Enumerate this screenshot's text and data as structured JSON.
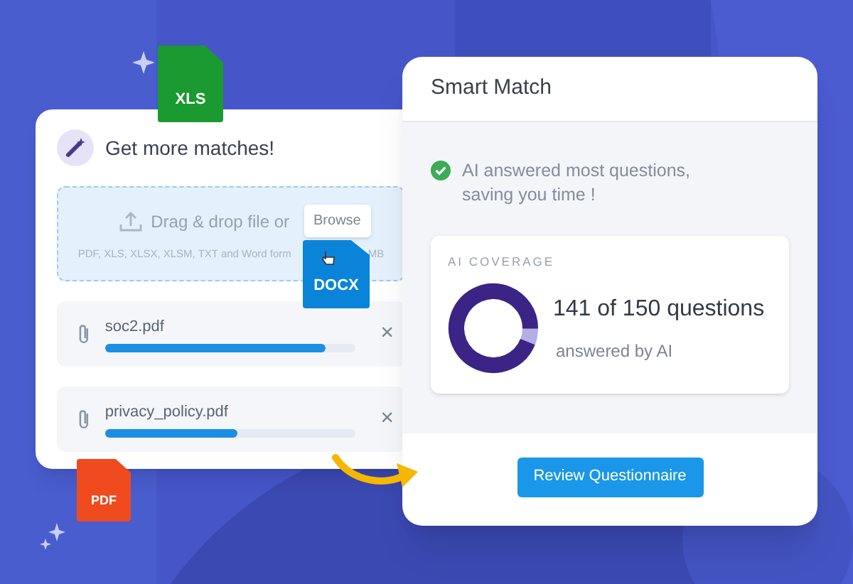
{
  "upload_card": {
    "title": "Get more matches!",
    "dropzone": {
      "prompt": "Drag & drop file or",
      "browse_button": "Browse",
      "hint_start": "PDF, XLS, XLSX, XLSM, TXT and Word form",
      "hint_end": "MB"
    },
    "files": [
      {
        "name": "soc2.pdf",
        "level": 0.88,
        "remove": "×"
      },
      {
        "name": "privacy_policy.pdf",
        "level": 0.53,
        "remove": "×"
      }
    ]
  },
  "file_tiles": [
    {
      "label": "XLS",
      "color": "#1a9a30"
    },
    {
      "label": "DOCX",
      "color": "#0a84d8"
    },
    {
      "label": "PDF",
      "color": "#f04a1f"
    }
  ],
  "smart_match": {
    "title": "Smart Match",
    "status": "AI answered most questions, saving you time !",
    "coverage": {
      "heading": "AI COVERAGE",
      "level": 0.94,
      "count": "141 of 150 questions",
      "caption": "answered by AI"
    },
    "review_button": "Review Questionnaire"
  }
}
